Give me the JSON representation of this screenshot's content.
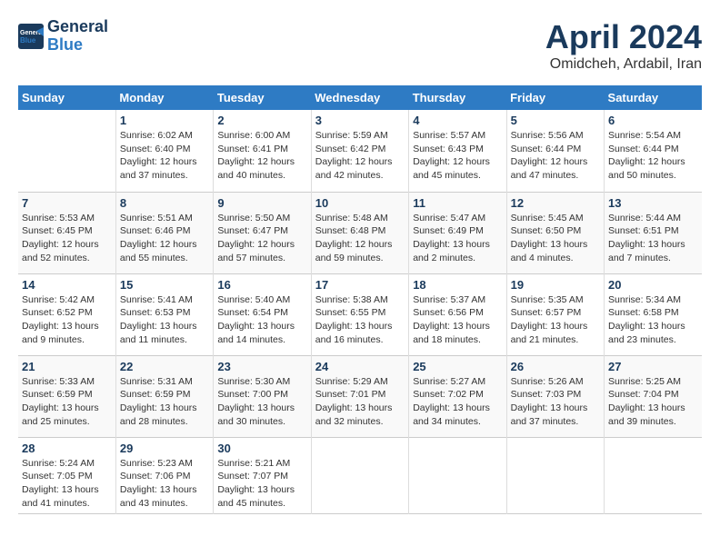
{
  "logo": {
    "line1": "General",
    "line2": "Blue"
  },
  "title": "April 2024",
  "location": "Omidcheh, Ardabil, Iran",
  "days_header": [
    "Sunday",
    "Monday",
    "Tuesday",
    "Wednesday",
    "Thursday",
    "Friday",
    "Saturday"
  ],
  "weeks": [
    [
      {
        "num": "",
        "info": ""
      },
      {
        "num": "1",
        "info": "Sunrise: 6:02 AM\nSunset: 6:40 PM\nDaylight: 12 hours\nand 37 minutes."
      },
      {
        "num": "2",
        "info": "Sunrise: 6:00 AM\nSunset: 6:41 PM\nDaylight: 12 hours\nand 40 minutes."
      },
      {
        "num": "3",
        "info": "Sunrise: 5:59 AM\nSunset: 6:42 PM\nDaylight: 12 hours\nand 42 minutes."
      },
      {
        "num": "4",
        "info": "Sunrise: 5:57 AM\nSunset: 6:43 PM\nDaylight: 12 hours\nand 45 minutes."
      },
      {
        "num": "5",
        "info": "Sunrise: 5:56 AM\nSunset: 6:44 PM\nDaylight: 12 hours\nand 47 minutes."
      },
      {
        "num": "6",
        "info": "Sunrise: 5:54 AM\nSunset: 6:44 PM\nDaylight: 12 hours\nand 50 minutes."
      }
    ],
    [
      {
        "num": "7",
        "info": "Sunrise: 5:53 AM\nSunset: 6:45 PM\nDaylight: 12 hours\nand 52 minutes."
      },
      {
        "num": "8",
        "info": "Sunrise: 5:51 AM\nSunset: 6:46 PM\nDaylight: 12 hours\nand 55 minutes."
      },
      {
        "num": "9",
        "info": "Sunrise: 5:50 AM\nSunset: 6:47 PM\nDaylight: 12 hours\nand 57 minutes."
      },
      {
        "num": "10",
        "info": "Sunrise: 5:48 AM\nSunset: 6:48 PM\nDaylight: 12 hours\nand 59 minutes."
      },
      {
        "num": "11",
        "info": "Sunrise: 5:47 AM\nSunset: 6:49 PM\nDaylight: 13 hours\nand 2 minutes."
      },
      {
        "num": "12",
        "info": "Sunrise: 5:45 AM\nSunset: 6:50 PM\nDaylight: 13 hours\nand 4 minutes."
      },
      {
        "num": "13",
        "info": "Sunrise: 5:44 AM\nSunset: 6:51 PM\nDaylight: 13 hours\nand 7 minutes."
      }
    ],
    [
      {
        "num": "14",
        "info": "Sunrise: 5:42 AM\nSunset: 6:52 PM\nDaylight: 13 hours\nand 9 minutes."
      },
      {
        "num": "15",
        "info": "Sunrise: 5:41 AM\nSunset: 6:53 PM\nDaylight: 13 hours\nand 11 minutes."
      },
      {
        "num": "16",
        "info": "Sunrise: 5:40 AM\nSunset: 6:54 PM\nDaylight: 13 hours\nand 14 minutes."
      },
      {
        "num": "17",
        "info": "Sunrise: 5:38 AM\nSunset: 6:55 PM\nDaylight: 13 hours\nand 16 minutes."
      },
      {
        "num": "18",
        "info": "Sunrise: 5:37 AM\nSunset: 6:56 PM\nDaylight: 13 hours\nand 18 minutes."
      },
      {
        "num": "19",
        "info": "Sunrise: 5:35 AM\nSunset: 6:57 PM\nDaylight: 13 hours\nand 21 minutes."
      },
      {
        "num": "20",
        "info": "Sunrise: 5:34 AM\nSunset: 6:58 PM\nDaylight: 13 hours\nand 23 minutes."
      }
    ],
    [
      {
        "num": "21",
        "info": "Sunrise: 5:33 AM\nSunset: 6:59 PM\nDaylight: 13 hours\nand 25 minutes."
      },
      {
        "num": "22",
        "info": "Sunrise: 5:31 AM\nSunset: 6:59 PM\nDaylight: 13 hours\nand 28 minutes."
      },
      {
        "num": "23",
        "info": "Sunrise: 5:30 AM\nSunset: 7:00 PM\nDaylight: 13 hours\nand 30 minutes."
      },
      {
        "num": "24",
        "info": "Sunrise: 5:29 AM\nSunset: 7:01 PM\nDaylight: 13 hours\nand 32 minutes."
      },
      {
        "num": "25",
        "info": "Sunrise: 5:27 AM\nSunset: 7:02 PM\nDaylight: 13 hours\nand 34 minutes."
      },
      {
        "num": "26",
        "info": "Sunrise: 5:26 AM\nSunset: 7:03 PM\nDaylight: 13 hours\nand 37 minutes."
      },
      {
        "num": "27",
        "info": "Sunrise: 5:25 AM\nSunset: 7:04 PM\nDaylight: 13 hours\nand 39 minutes."
      }
    ],
    [
      {
        "num": "28",
        "info": "Sunrise: 5:24 AM\nSunset: 7:05 PM\nDaylight: 13 hours\nand 41 minutes."
      },
      {
        "num": "29",
        "info": "Sunrise: 5:23 AM\nSunset: 7:06 PM\nDaylight: 13 hours\nand 43 minutes."
      },
      {
        "num": "30",
        "info": "Sunrise: 5:21 AM\nSunset: 7:07 PM\nDaylight: 13 hours\nand 45 minutes."
      },
      {
        "num": "",
        "info": ""
      },
      {
        "num": "",
        "info": ""
      },
      {
        "num": "",
        "info": ""
      },
      {
        "num": "",
        "info": ""
      }
    ]
  ]
}
